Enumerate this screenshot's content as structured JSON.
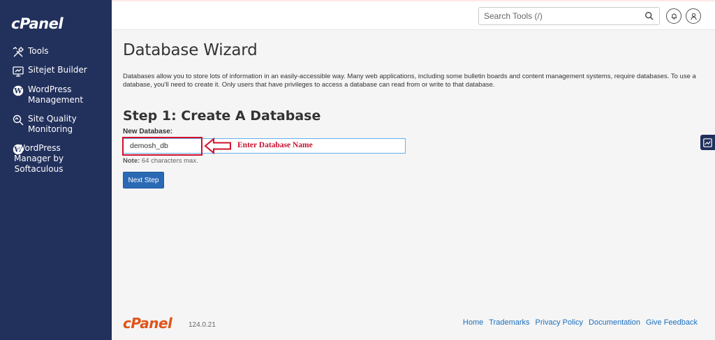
{
  "brand": {
    "logo_text": "cPanel",
    "footer_logo_text": "cPanel",
    "version": "124.0.21",
    "accent": "#e0531a",
    "sidebar_bg": "#22305c"
  },
  "sidebar": {
    "items": [
      {
        "label": "Tools",
        "icon": "tools-icon"
      },
      {
        "label": "Sitejet Builder",
        "icon": "sitejet-icon"
      },
      {
        "label": "WordPress\nManagement",
        "icon": "wordpress-icon"
      },
      {
        "label": "Site Quality\nMonitoring",
        "icon": "site-quality-icon"
      },
      {
        "label": "WordPress\nManager by\nSoftaculous",
        "icon": "wordpress-icon"
      }
    ]
  },
  "header": {
    "search_placeholder": "Search Tools (/)"
  },
  "main": {
    "title": "Database Wizard",
    "intro": "Databases allow you to store lots of information in an easily-accessible way. Many web applications, including some bulletin boards and content management systems, require databases. To use a database, you'll need to create it. Only users that have privileges to access a database can read from or write to that database.",
    "step_title": "Step 1: Create A Database",
    "field_label": "New Database:",
    "field_value": "demosh_db",
    "annotation": "Enter Database Name",
    "note_label": "Note:",
    "note_text": " 64 characters max.",
    "next_button": "Next Step"
  },
  "footer": {
    "links": [
      "Home",
      "Trademarks",
      "Privacy Policy",
      "Documentation",
      "Give Feedback"
    ]
  }
}
